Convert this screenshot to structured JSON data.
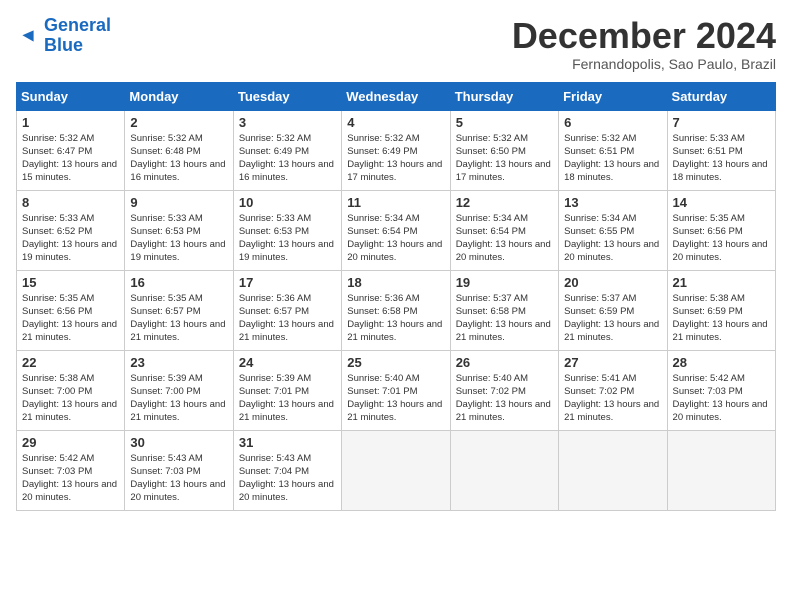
{
  "header": {
    "logo_general": "General",
    "logo_blue": "Blue",
    "month_title": "December 2024",
    "subtitle": "Fernandopolis, Sao Paulo, Brazil"
  },
  "calendar": {
    "days_of_week": [
      "Sunday",
      "Monday",
      "Tuesday",
      "Wednesday",
      "Thursday",
      "Friday",
      "Saturday"
    ],
    "weeks": [
      [
        {
          "day": "1",
          "sunrise": "5:32 AM",
          "sunset": "6:47 PM",
          "daylight": "13 hours and 15 minutes."
        },
        {
          "day": "2",
          "sunrise": "5:32 AM",
          "sunset": "6:48 PM",
          "daylight": "13 hours and 16 minutes."
        },
        {
          "day": "3",
          "sunrise": "5:32 AM",
          "sunset": "6:49 PM",
          "daylight": "13 hours and 16 minutes."
        },
        {
          "day": "4",
          "sunrise": "5:32 AM",
          "sunset": "6:49 PM",
          "daylight": "13 hours and 17 minutes."
        },
        {
          "day": "5",
          "sunrise": "5:32 AM",
          "sunset": "6:50 PM",
          "daylight": "13 hours and 17 minutes."
        },
        {
          "day": "6",
          "sunrise": "5:32 AM",
          "sunset": "6:51 PM",
          "daylight": "13 hours and 18 minutes."
        },
        {
          "day": "7",
          "sunrise": "5:33 AM",
          "sunset": "6:51 PM",
          "daylight": "13 hours and 18 minutes."
        }
      ],
      [
        {
          "day": "8",
          "sunrise": "5:33 AM",
          "sunset": "6:52 PM",
          "daylight": "13 hours and 19 minutes."
        },
        {
          "day": "9",
          "sunrise": "5:33 AM",
          "sunset": "6:53 PM",
          "daylight": "13 hours and 19 minutes."
        },
        {
          "day": "10",
          "sunrise": "5:33 AM",
          "sunset": "6:53 PM",
          "daylight": "13 hours and 19 minutes."
        },
        {
          "day": "11",
          "sunrise": "5:34 AM",
          "sunset": "6:54 PM",
          "daylight": "13 hours and 20 minutes."
        },
        {
          "day": "12",
          "sunrise": "5:34 AM",
          "sunset": "6:54 PM",
          "daylight": "13 hours and 20 minutes."
        },
        {
          "day": "13",
          "sunrise": "5:34 AM",
          "sunset": "6:55 PM",
          "daylight": "13 hours and 20 minutes."
        },
        {
          "day": "14",
          "sunrise": "5:35 AM",
          "sunset": "6:56 PM",
          "daylight": "13 hours and 20 minutes."
        }
      ],
      [
        {
          "day": "15",
          "sunrise": "5:35 AM",
          "sunset": "6:56 PM",
          "daylight": "13 hours and 21 minutes."
        },
        {
          "day": "16",
          "sunrise": "5:35 AM",
          "sunset": "6:57 PM",
          "daylight": "13 hours and 21 minutes."
        },
        {
          "day": "17",
          "sunrise": "5:36 AM",
          "sunset": "6:57 PM",
          "daylight": "13 hours and 21 minutes."
        },
        {
          "day": "18",
          "sunrise": "5:36 AM",
          "sunset": "6:58 PM",
          "daylight": "13 hours and 21 minutes."
        },
        {
          "day": "19",
          "sunrise": "5:37 AM",
          "sunset": "6:58 PM",
          "daylight": "13 hours and 21 minutes."
        },
        {
          "day": "20",
          "sunrise": "5:37 AM",
          "sunset": "6:59 PM",
          "daylight": "13 hours and 21 minutes."
        },
        {
          "day": "21",
          "sunrise": "5:38 AM",
          "sunset": "6:59 PM",
          "daylight": "13 hours and 21 minutes."
        }
      ],
      [
        {
          "day": "22",
          "sunrise": "5:38 AM",
          "sunset": "7:00 PM",
          "daylight": "13 hours and 21 minutes."
        },
        {
          "day": "23",
          "sunrise": "5:39 AM",
          "sunset": "7:00 PM",
          "daylight": "13 hours and 21 minutes."
        },
        {
          "day": "24",
          "sunrise": "5:39 AM",
          "sunset": "7:01 PM",
          "daylight": "13 hours and 21 minutes."
        },
        {
          "day": "25",
          "sunrise": "5:40 AM",
          "sunset": "7:01 PM",
          "daylight": "13 hours and 21 minutes."
        },
        {
          "day": "26",
          "sunrise": "5:40 AM",
          "sunset": "7:02 PM",
          "daylight": "13 hours and 21 minutes."
        },
        {
          "day": "27",
          "sunrise": "5:41 AM",
          "sunset": "7:02 PM",
          "daylight": "13 hours and 21 minutes."
        },
        {
          "day": "28",
          "sunrise": "5:42 AM",
          "sunset": "7:03 PM",
          "daylight": "13 hours and 20 minutes."
        }
      ],
      [
        {
          "day": "29",
          "sunrise": "5:42 AM",
          "sunset": "7:03 PM",
          "daylight": "13 hours and 20 minutes."
        },
        {
          "day": "30",
          "sunrise": "5:43 AM",
          "sunset": "7:03 PM",
          "daylight": "13 hours and 20 minutes."
        },
        {
          "day": "31",
          "sunrise": "5:43 AM",
          "sunset": "7:04 PM",
          "daylight": "13 hours and 20 minutes."
        },
        null,
        null,
        null,
        null
      ]
    ]
  }
}
